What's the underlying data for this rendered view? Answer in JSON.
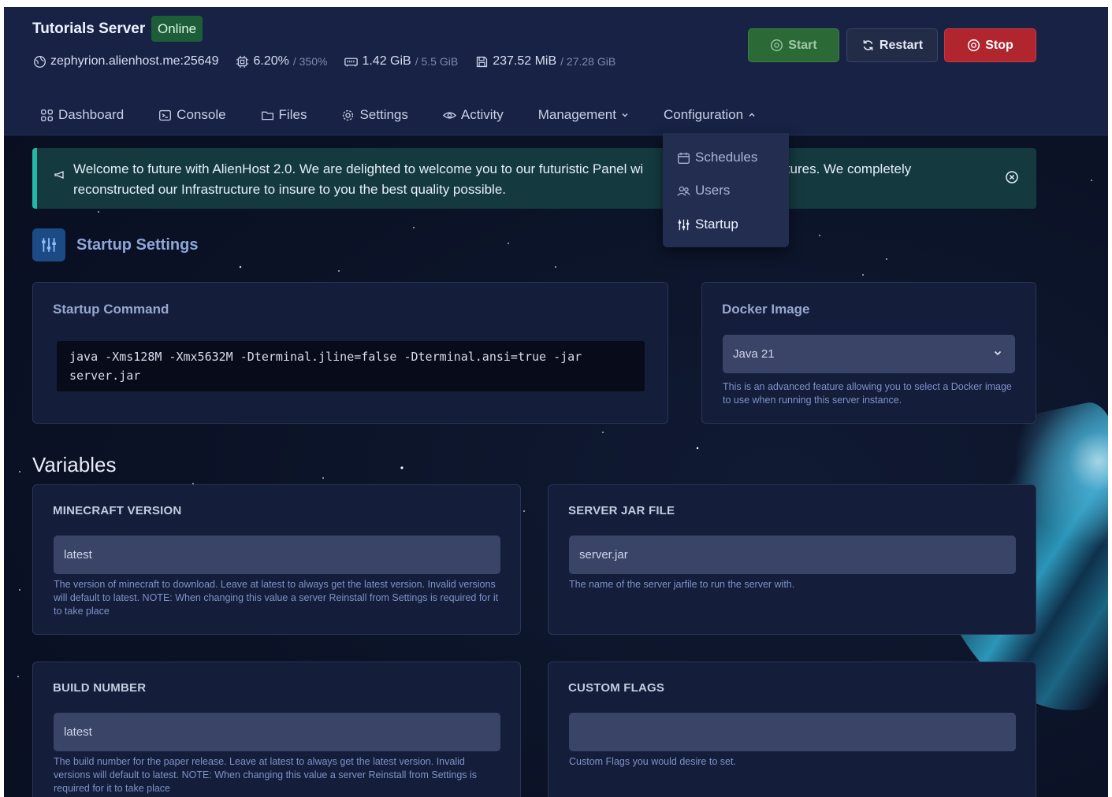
{
  "server": {
    "name": "Tutorials Server",
    "status": "Online",
    "address": "zephyrion.alienhost.me:25649",
    "cpu": "6.20%",
    "cpu_limit": "/ 350%",
    "memory": "1.42 GiB",
    "memory_limit": "/ 5.5 GiB",
    "disk": "237.52 MiB",
    "disk_limit": "/ 27.28 GiB"
  },
  "power": {
    "start": "Start",
    "restart": "Restart",
    "stop": "Stop"
  },
  "nav": {
    "dashboard": "Dashboard",
    "console": "Console",
    "files": "Files",
    "settings": "Settings",
    "activity": "Activity",
    "management": "Management",
    "configuration": "Configuration"
  },
  "config_menu": {
    "schedules": "Schedules",
    "users": "Users",
    "startup": "Startup"
  },
  "banner": {
    "line1": "Welcome to future with AlienHost 2.0. We are delighted to welcome you to our futuristic Panel wi",
    "line1_tail": "features. We completely",
    "line2": "reconstructed our Infrastructure to insure to you the best quality possible."
  },
  "startup": {
    "section_title": "Startup Settings",
    "command_title": "Startup Command",
    "command": "java -Xms128M -Xmx5632M -Dterminal.jline=false -Dterminal.ansi=true -jar server.jar",
    "docker_title": "Docker Image",
    "docker_value": "Java 21",
    "docker_desc": "This is an advanced feature allowing you to select a Docker image to use when running this server instance."
  },
  "variables": {
    "title": "Variables",
    "items": [
      {
        "label": "MINECRAFT VERSION",
        "value": "latest",
        "desc": "The version of minecraft to download. Leave at latest to always get the latest version. Invalid versions will default to latest. NOTE: When changing this value a server Reinstall from Settings is required for it to take place"
      },
      {
        "label": "SERVER JAR FILE",
        "value": "server.jar",
        "desc": "The name of the server jarfile to run the server with."
      },
      {
        "label": "BUILD NUMBER",
        "value": "latest",
        "desc": "The build number for the paper release. Leave at latest to always get the latest version. Invalid versions will default to latest. NOTE: When changing this value a server Reinstall from Settings is required for it to take place"
      },
      {
        "label": "CUSTOM FLAGS",
        "value": "",
        "desc": "Custom Flags you would desire to set."
      }
    ]
  },
  "colors": {
    "accent": "#25b7a6",
    "start": "#2b6a37",
    "stop": "#b1262e",
    "online": "#1d5e38"
  }
}
